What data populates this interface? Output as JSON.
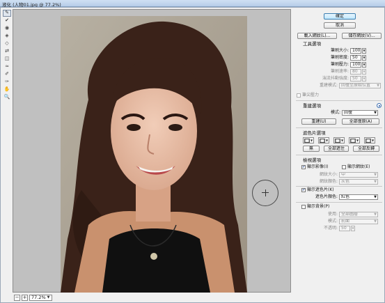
{
  "window": {
    "title": "液化 (人物01.jpg @ 77.2%)"
  },
  "tools": [
    {
      "icon": "forward-warp-tool-icon",
      "glyph": "✎",
      "active": true
    },
    {
      "icon": "reconstruct-tool-icon",
      "glyph": "✔",
      "active": false
    },
    {
      "icon": "twirl-clockwise-tool-icon",
      "glyph": "◉",
      "active": false
    },
    {
      "icon": "pucker-tool-icon",
      "glyph": "◈",
      "active": false
    },
    {
      "icon": "bloat-tool-icon",
      "glyph": "◇",
      "active": false
    },
    {
      "icon": "push-left-tool-icon",
      "glyph": "⇄",
      "active": false
    },
    {
      "icon": "mirror-tool-icon",
      "glyph": "◫",
      "active": false
    },
    {
      "icon": "turbulence-tool-icon",
      "glyph": "≈",
      "active": false
    },
    {
      "icon": "freeze-mask-tool-icon",
      "glyph": "✐",
      "active": false
    },
    {
      "icon": "thaw-mask-tool-icon",
      "glyph": "✑",
      "active": false
    },
    {
      "icon": "hand-tool-icon",
      "glyph": "✋",
      "active": false
    },
    {
      "icon": "zoom-tool-icon",
      "glyph": "🔍",
      "active": false
    }
  ],
  "status": {
    "zoom_minus": "−",
    "zoom_plus": "+",
    "zoom_value": "77.2%"
  },
  "panel": {
    "ok": "確定",
    "cancel": "取消",
    "load_mesh": "載入網紋(L)...",
    "save_mesh": "儲存網紋(V)...",
    "tool_options": {
      "title": "工具選項",
      "brush_size_label": "筆刷大小:",
      "brush_size": "100",
      "brush_density_label": "筆刷密度:",
      "brush_density": "50",
      "brush_pressure_label": "筆刷壓力:",
      "brush_pressure": "100",
      "brush_rate_label": "筆刷速率:",
      "brush_rate": "80",
      "turbulent_jitter_label": "湍流抖動強度:",
      "turbulent_jitter": "50",
      "reconstruct_mode_label": "重建模式:",
      "reconstruct_mode": "回復至原始位置",
      "stylus_pressure": "筆尖壓力"
    },
    "reconstruct_options": {
      "title": "重建選項",
      "mode_label": "模式:",
      "mode": "回復",
      "reconstruct_btn": "重建(U)",
      "restore_all_btn": "全部復原(A)"
    },
    "mask_options": {
      "title": "遮色片選項",
      "none_btn": "無",
      "mask_all_btn": "全部遮住",
      "invert_all_btn": "全部反轉"
    },
    "view_options": {
      "title": "檢視選項",
      "show_image": "顯示影像(I)",
      "show_mesh": "顯示網紋(E)",
      "mesh_size_label": "網紋大小:",
      "mesh_size": "中",
      "mesh_color_label": "網紋顏色:",
      "mesh_color": "灰色",
      "show_mask": "顯示遮色片(K)",
      "mask_color_label": "遮色片顏色:",
      "mask_color": "紅色",
      "show_backdrop": "顯示背景(P)",
      "use_label": "使用:",
      "use_value": "全部圖層",
      "backdrop_mode_label": "模式:",
      "backdrop_mode": "前面",
      "opacity_label": "不透明:",
      "opacity": "50"
    }
  }
}
